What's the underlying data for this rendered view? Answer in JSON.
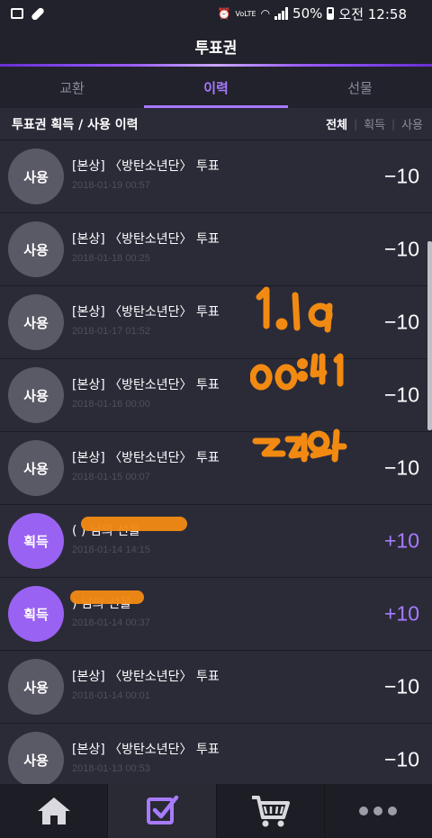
{
  "status_bar": {
    "battery": "50%",
    "time": "오전 12:58",
    "volte": "VoLTE"
  },
  "header": {
    "title": "투표권"
  },
  "tabs": [
    {
      "label": "교환",
      "active": false
    },
    {
      "label": "이력",
      "active": true
    },
    {
      "label": "선물",
      "active": false
    }
  ],
  "list": {
    "title": "투표권 획득 / 사용 이력",
    "filters": [
      {
        "label": "전체",
        "active": true
      },
      {
        "label": "획득",
        "active": false
      },
      {
        "label": "사용",
        "active": false
      }
    ]
  },
  "rows": [
    {
      "type": "use",
      "badge": "사용",
      "title": "[본상] 〈방탄소년단〉 투표",
      "date": "2018-01-19 00:57",
      "amount": "−10"
    },
    {
      "type": "use",
      "badge": "사용",
      "title": "[본상] 〈방탄소년단〉 투표",
      "date": "2018-01-18 00:25",
      "amount": "−10"
    },
    {
      "type": "use",
      "badge": "사용",
      "title": "[본상] 〈방탄소년단〉 투표",
      "date": "2018-01-17 01:52",
      "amount": "−10"
    },
    {
      "type": "use",
      "badge": "사용",
      "title": "[본상] 〈방탄소년단〉 투표",
      "date": "2018-01-16 00:00",
      "amount": "−10"
    },
    {
      "type": "use",
      "badge": "사용",
      "title": "[본상] 〈방탄소년단〉 투표",
      "date": "2018-01-15 00:07",
      "amount": "−10"
    },
    {
      "type": "gain",
      "badge": "획득",
      "title": "(                   ) 님의 선물",
      "date": "2018-01-14 14:15",
      "amount": "+10"
    },
    {
      "type": "gain",
      "badge": "획득",
      "title": "                 ) 님의 선물",
      "date": "2018-01-14 00:37",
      "amount": "+10"
    },
    {
      "type": "use",
      "badge": "사용",
      "title": "[본상] 〈방탄소년단〉 투표",
      "date": "2018-01-14 00:01",
      "amount": "−10"
    },
    {
      "type": "use",
      "badge": "사용",
      "title": "[본상] 〈방탄소년단〉 투표",
      "date": "2018-01-13 00:53",
      "amount": "−10"
    }
  ],
  "nav": [
    {
      "icon": "home-icon",
      "active": false
    },
    {
      "icon": "vote-check-icon",
      "active": true
    },
    {
      "icon": "cart-icon",
      "active": false
    },
    {
      "icon": "more-icon",
      "active": false
    }
  ],
  "colors": {
    "background": "#2b2b38",
    "accent": "#a77bff",
    "use_badge": "#5a5966",
    "gain_badge": "#9a62f2",
    "scribble": "#f28a12"
  }
}
